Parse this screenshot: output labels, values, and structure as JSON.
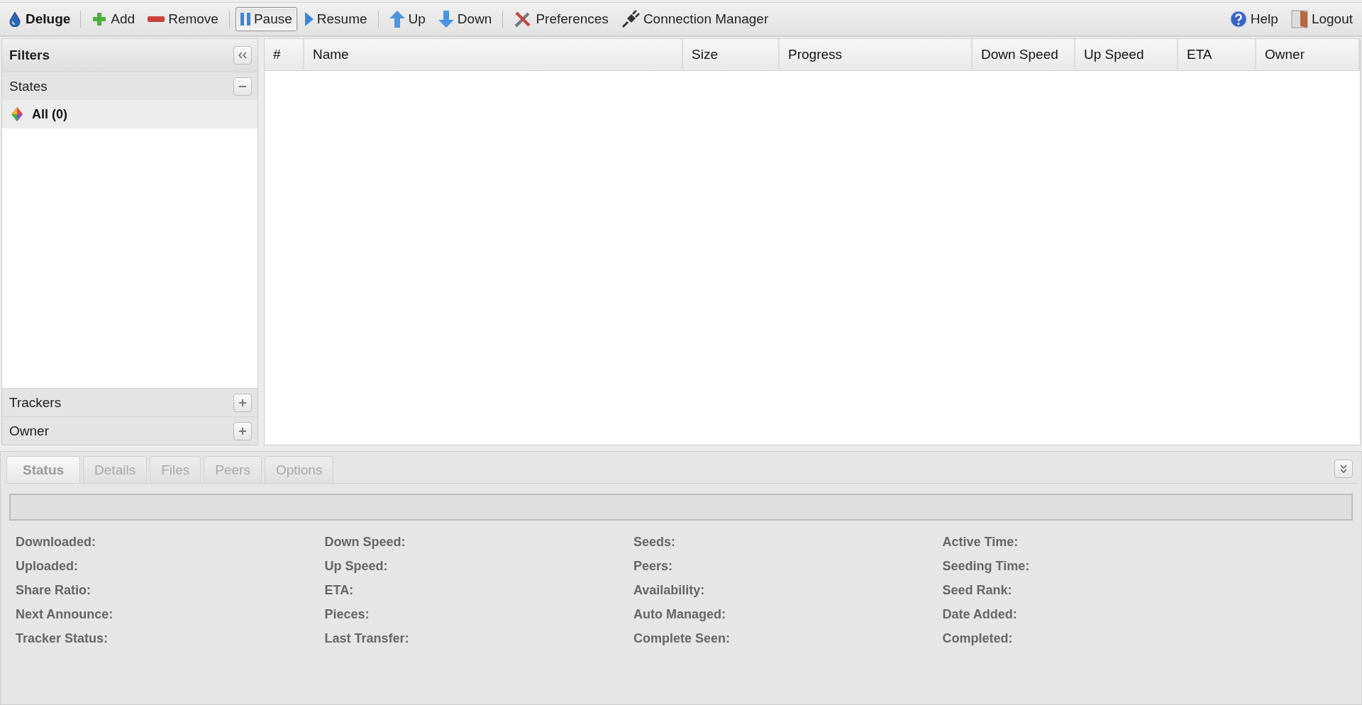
{
  "toolbar": {
    "logo": "Deluge",
    "buttons": [
      {
        "kind": "add",
        "label": "Add",
        "pressed": false
      },
      {
        "kind": "remove",
        "label": "Remove",
        "pressed": false
      },
      {
        "kind": "pause",
        "label": "Pause",
        "pressed": true
      },
      {
        "kind": "resume",
        "label": "Resume",
        "pressed": false
      },
      {
        "kind": "up",
        "label": "Up",
        "pressed": false
      },
      {
        "kind": "down",
        "label": "Down",
        "pressed": false
      },
      {
        "kind": "preferences",
        "label": "Preferences",
        "pressed": false
      },
      {
        "kind": "connection",
        "label": "Connection Manager",
        "pressed": false
      }
    ],
    "right_buttons": [
      {
        "kind": "help",
        "label": "Help"
      },
      {
        "kind": "logout",
        "label": "Logout"
      }
    ]
  },
  "filters": {
    "title": "Filters",
    "sections": [
      {
        "label": "States",
        "expanded": true,
        "items": [
          {
            "label": "All (0)",
            "selected": true
          }
        ]
      },
      {
        "label": "Trackers",
        "expanded": false
      },
      {
        "label": "Owner",
        "expanded": false
      }
    ]
  },
  "table": {
    "columns": [
      "#",
      "Name",
      "Size",
      "Progress",
      "Down Speed",
      "Up Speed",
      "ETA",
      "Owner"
    ]
  },
  "details": {
    "tabs": [
      {
        "label": "Status",
        "selected": true
      },
      {
        "label": "Details",
        "selected": false
      },
      {
        "label": "Files",
        "selected": false
      },
      {
        "label": "Peers",
        "selected": false
      },
      {
        "label": "Options",
        "selected": false
      }
    ],
    "progress": {
      "level": 0
    },
    "fields": [
      [
        "Downloaded:",
        "Uploaded:",
        "Share Ratio:",
        "Next Announce:",
        "Tracker Status:"
      ],
      [
        "Down Speed:",
        "Up Speed:",
        "ETA:",
        "Pieces:",
        "Last Transfer:"
      ],
      [
        "Seeds:",
        "Peers:",
        "Availability:",
        "Auto Managed:",
        "Complete Seen:"
      ],
      [
        "Active Time:",
        "Seeding Time:",
        "Seed Rank:",
        "Date Added:",
        "Completed:"
      ]
    ]
  }
}
